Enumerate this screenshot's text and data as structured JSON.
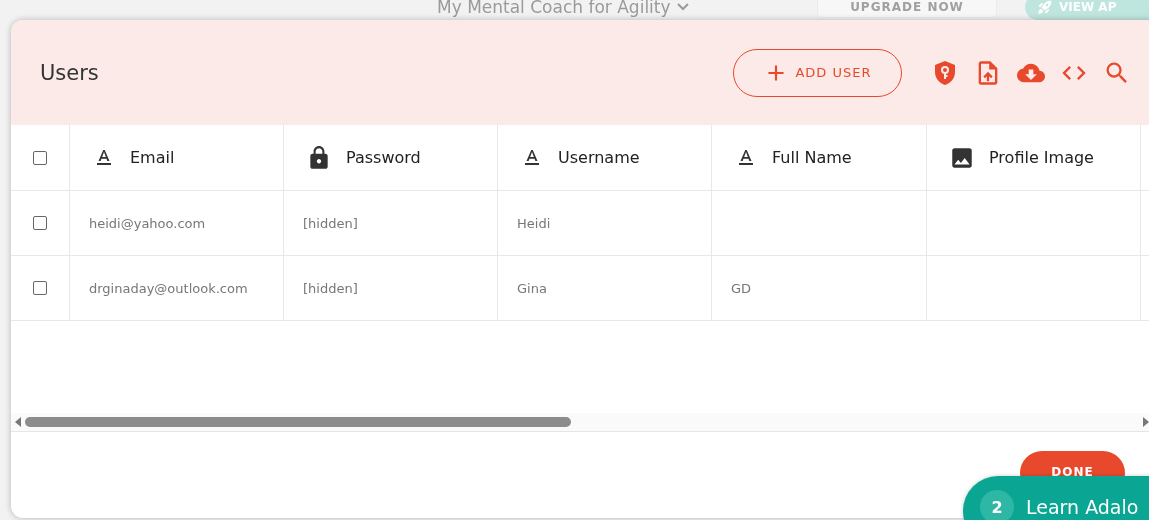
{
  "app_bar": {
    "app_name": "My Mental Coach for Agility",
    "upgrade_button": "UPGRADE NOW",
    "view_button": "VIEW AP"
  },
  "dialog": {
    "title": "Users",
    "add_button": "ADD USER",
    "table": {
      "all_checked": false,
      "columns": [
        {
          "label": "Email",
          "kind": "text"
        },
        {
          "label": "Password",
          "kind": "password"
        },
        {
          "label": "Username",
          "kind": "text"
        },
        {
          "label": "Full Name",
          "kind": "text"
        },
        {
          "label": "Profile Image",
          "kind": "image"
        }
      ],
      "rows": [
        {
          "checked": false,
          "cells": [
            "heidi@yahoo.com",
            "[hidden]",
            "Heidi",
            "",
            ""
          ]
        },
        {
          "checked": false,
          "cells": [
            "drginaday@outlook.com",
            "[hidden]",
            "Gina",
            "GD",
            ""
          ]
        }
      ]
    },
    "done_button": "DONE"
  },
  "learn_widget": {
    "step": "2",
    "label": "Learn Adalo"
  }
}
